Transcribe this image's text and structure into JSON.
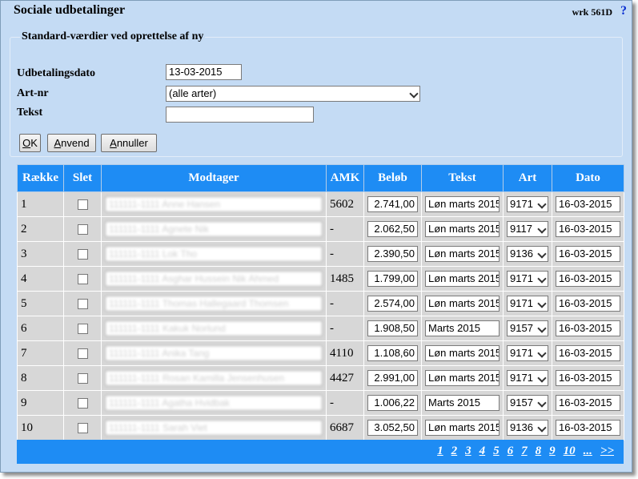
{
  "title": "Sociale udbetalinger",
  "wrk_code": "wrk 561D",
  "help_symbol": "?",
  "standard": {
    "legend": "Standard-værdier ved oprettelse af ny",
    "date_label": "Udbetalingsdato",
    "date_value": "13-03-2015",
    "art_label": "Art-nr",
    "art_value": "(alle arter)",
    "text_label": "Tekst",
    "text_value": ""
  },
  "buttons": {
    "ok": "OK",
    "apply": "Anvend",
    "cancel": "Annuller"
  },
  "table": {
    "headers": [
      "Række",
      "Slet",
      "Modtager",
      "AMK",
      "Beløb",
      "Tekst",
      "Art",
      "Dato"
    ],
    "rows": [
      {
        "nr": "1",
        "recipient": "111111-1111 Anne Hansen",
        "amk": "5602",
        "amount": "2.741,00",
        "text": "Løn marts 2015",
        "art": "9171",
        "date": "16-03-2015"
      },
      {
        "nr": "2",
        "recipient": "111111-1111 Agnete Nik",
        "amk": "-",
        "amount": "2.062,50",
        "text": "Løn marts 2015",
        "art": "9117",
        "date": "16-03-2015"
      },
      {
        "nr": "3",
        "recipient": "111111-1111 Lok Tho",
        "amk": "-",
        "amount": "2.390,50",
        "text": "Løn marts 2015",
        "art": "9136",
        "date": "16-03-2015"
      },
      {
        "nr": "4",
        "recipient": "111111-1111 Asghar Hussein Nik Ahmed",
        "amk": "1485",
        "amount": "1.799,00",
        "text": "Løn marts 2015",
        "art": "9171",
        "date": "16-03-2015"
      },
      {
        "nr": "5",
        "recipient": "111111-1111 Thomas Hallegaard Thomsen",
        "amk": "-",
        "amount": "2.574,00",
        "text": "Løn marts 2015",
        "art": "9171",
        "date": "16-03-2015"
      },
      {
        "nr": "6",
        "recipient": "111111-1111 Kakuk Norlund",
        "amk": "-",
        "amount": "1.908,50",
        "text": "Marts 2015",
        "art": "9157",
        "date": "16-03-2015"
      },
      {
        "nr": "7",
        "recipient": "111111-1111 Anika Tang",
        "amk": "4110",
        "amount": "1.108,60",
        "text": "Løn marts 2015",
        "art": "9171",
        "date": "16-03-2015"
      },
      {
        "nr": "8",
        "recipient": "111111-1111 Rosan Kamilla Jensenhusen",
        "amk": "4427",
        "amount": "2.991,00",
        "text": "Løn marts 2015",
        "art": "9171",
        "date": "16-03-2015"
      },
      {
        "nr": "9",
        "recipient": "111111-1111 Agatha Hvidbak",
        "amk": "-",
        "amount": "1.006,22",
        "text": "Marts 2015",
        "art": "9157",
        "date": "16-03-2015"
      },
      {
        "nr": "10",
        "recipient": "111111-1111 Sarah Viet",
        "amk": "6687",
        "amount": "3.052,50",
        "text": "Løn marts 2015",
        "art": "9136",
        "date": "16-03-2015"
      }
    ]
  },
  "pager": [
    "1",
    "2",
    "3",
    "4",
    "5",
    "6",
    "7",
    "8",
    "9",
    "10",
    "...",
    ">>"
  ]
}
